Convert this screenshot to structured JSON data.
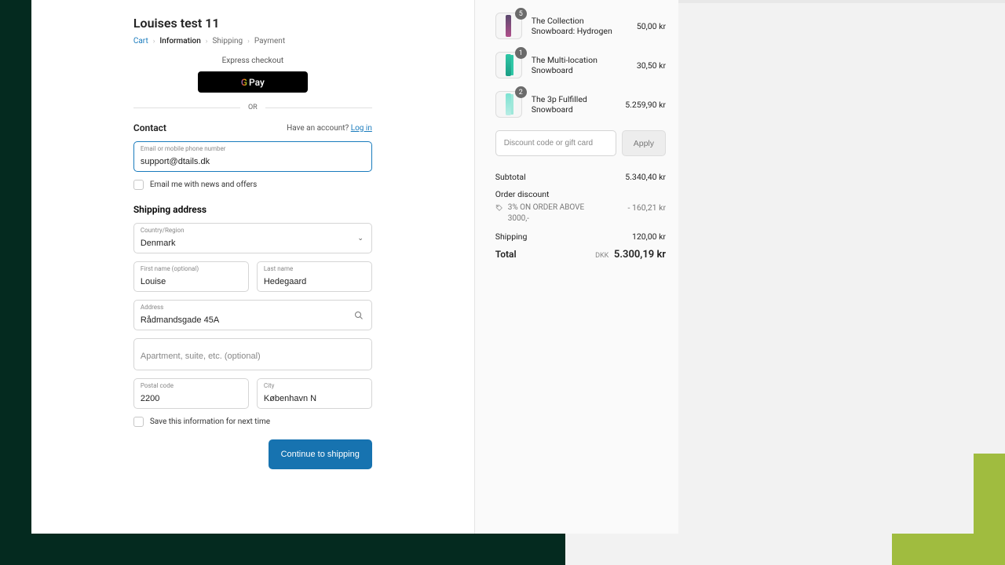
{
  "store_title": "Louises test 11",
  "breadcrumb": {
    "cart": "Cart",
    "information": "Information",
    "shipping": "Shipping",
    "payment": "Payment"
  },
  "express": {
    "label": "Express checkout",
    "gpay_g": "G",
    "gpay_pay": "Pay",
    "or": "OR"
  },
  "contact": {
    "heading": "Contact",
    "have_account": "Have an account?",
    "login": "Log in",
    "email_label": "Email or mobile phone number",
    "email_value": "support@dtails.dk",
    "news_label": "Email me with news and offers"
  },
  "shipping": {
    "heading": "Shipping address",
    "country_label": "Country/Region",
    "country_value": "Denmark",
    "first_label": "First name (optional)",
    "first_value": "Louise",
    "last_label": "Last name",
    "last_value": "Hedegaard",
    "address_label": "Address",
    "address_value": "Rådmandsgade 45A",
    "apt_placeholder": "Apartment, suite, etc. (optional)",
    "postal_label": "Postal code",
    "postal_value": "2200",
    "city_label": "City",
    "city_value": "København N",
    "save_label": "Save this information for next time"
  },
  "continue_label": "Continue to shipping",
  "items": [
    {
      "qty": "5",
      "name": "The Collection Snowboard: Hydrogen",
      "price": "50,00 kr"
    },
    {
      "qty": "1",
      "name": "The Multi-location Snowboard",
      "price": "30,50 kr"
    },
    {
      "qty": "2",
      "name": "The 3p Fulfilled Snowboard",
      "price": "5.259,90 kr"
    }
  ],
  "discount": {
    "placeholder": "Discount code or gift card",
    "apply": "Apply"
  },
  "summary": {
    "subtotal_label": "Subtotal",
    "subtotal_value": "5.340,40 kr",
    "orderdisc_label": "Order discount",
    "disc_name": "3% ON ORDER ABOVE 3000,-",
    "disc_value": "- 160,21 kr",
    "ship_label": "Shipping",
    "ship_value": "120,00 kr",
    "total_label": "Total",
    "currency": "DKK",
    "total_value": "5.300,19 kr"
  }
}
